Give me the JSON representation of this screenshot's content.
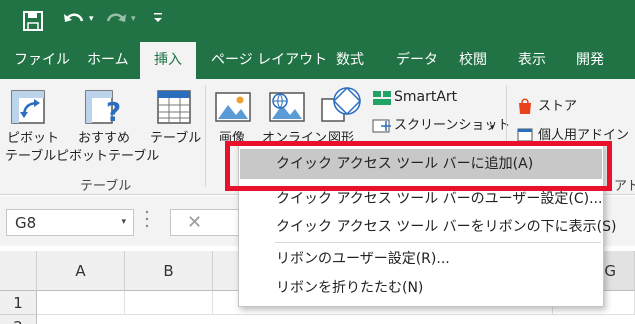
{
  "qat": {
    "undo_arrow": "▾",
    "redo_arrow": "▾",
    "customize": "▾"
  },
  "tabs": [
    "ファイル",
    "ホーム",
    "挿入",
    "ページ レイアウト",
    "数式",
    "データ",
    "校閲",
    "表示",
    "開発"
  ],
  "active_tab": "挿入",
  "ribbon": {
    "pivot_table": [
      "ピボット",
      "テーブル"
    ],
    "recommended_pivot": [
      "おすすめ",
      "ピボットテーブル"
    ],
    "table": "テーブル",
    "group_tables": "テーブル",
    "pictures": "画像",
    "online_pictures": "オンライン",
    "shapes": "図形",
    "smartart": "SmartArt",
    "screenshot": "スクリーンショット",
    "screenshot_arrow": "▾",
    "store": "ストア",
    "my_addins": "個人用アドイン",
    "group_addins": "アド"
  },
  "formula_bar": {
    "name_box": "G8",
    "name_arrow": "▾",
    "cancel": "✕"
  },
  "grid": {
    "columns": [
      "A",
      "B",
      "G"
    ],
    "rows": [
      "1",
      "2"
    ]
  },
  "context_menu": {
    "items": [
      "クイック アクセス ツール バーに追加(A)",
      "クイック アクセス ツール バーのユーザー設定(C)...",
      "クイック アクセス ツール バーをリボンの下に表示(S)",
      "リボンのユーザー設定(R)...",
      "リボンを折りたたむ(N)"
    ]
  },
  "colors": {
    "excel_green": "#217346",
    "ribbon_bg": "#f3f3f3",
    "highlight": "#e8102a"
  }
}
